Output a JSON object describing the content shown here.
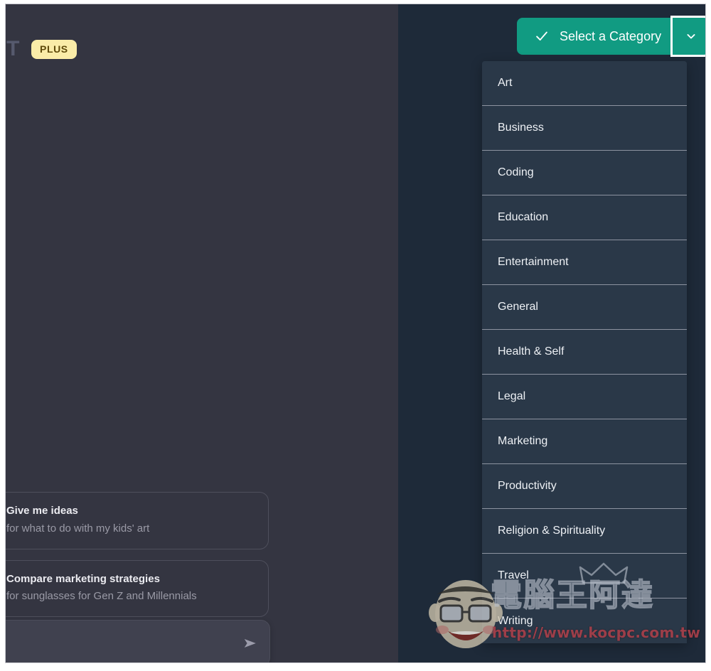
{
  "app": {
    "brand_wordmark": "ChatGPT",
    "plan_badge": "PLUS"
  },
  "composer": {
    "placeholder": "",
    "value": "",
    "send_icon": "send-arrow-icon"
  },
  "suggestions": [
    {
      "title": "Give me ideas",
      "subtitle": "for what to do with my kids' art"
    },
    {
      "title": "Compare marketing strategies",
      "subtitle": "for sunglasses for Gen Z and Millennials"
    }
  ],
  "category_selector": {
    "button_label": "Select a Category",
    "check_icon": "check-icon",
    "chevron_icon": "chevron-down-icon",
    "accent_color": "#119b82",
    "focus_ring_color": "#ffffff",
    "expanded": true,
    "items": [
      "Art",
      "Business",
      "Coding",
      "Education",
      "Entertainment",
      "General",
      "Health & Self",
      "Legal",
      "Marketing",
      "Productivity",
      "Religion & Spirituality",
      "Travel",
      "Writing"
    ]
  },
  "watermark": {
    "brand": "電腦王阿達",
    "url": "http://www.kocpc.com.tw",
    "face_icon": "cartoon-face-icon",
    "crown_icon": "crown-icon",
    "url_color": "#b2404a"
  },
  "theme": {
    "chat_background": "#343541",
    "panel_background": "#1e2a39",
    "list_background": "#2a3848",
    "badge_background": "#faeca8",
    "badge_text": "#5f4a0a"
  }
}
